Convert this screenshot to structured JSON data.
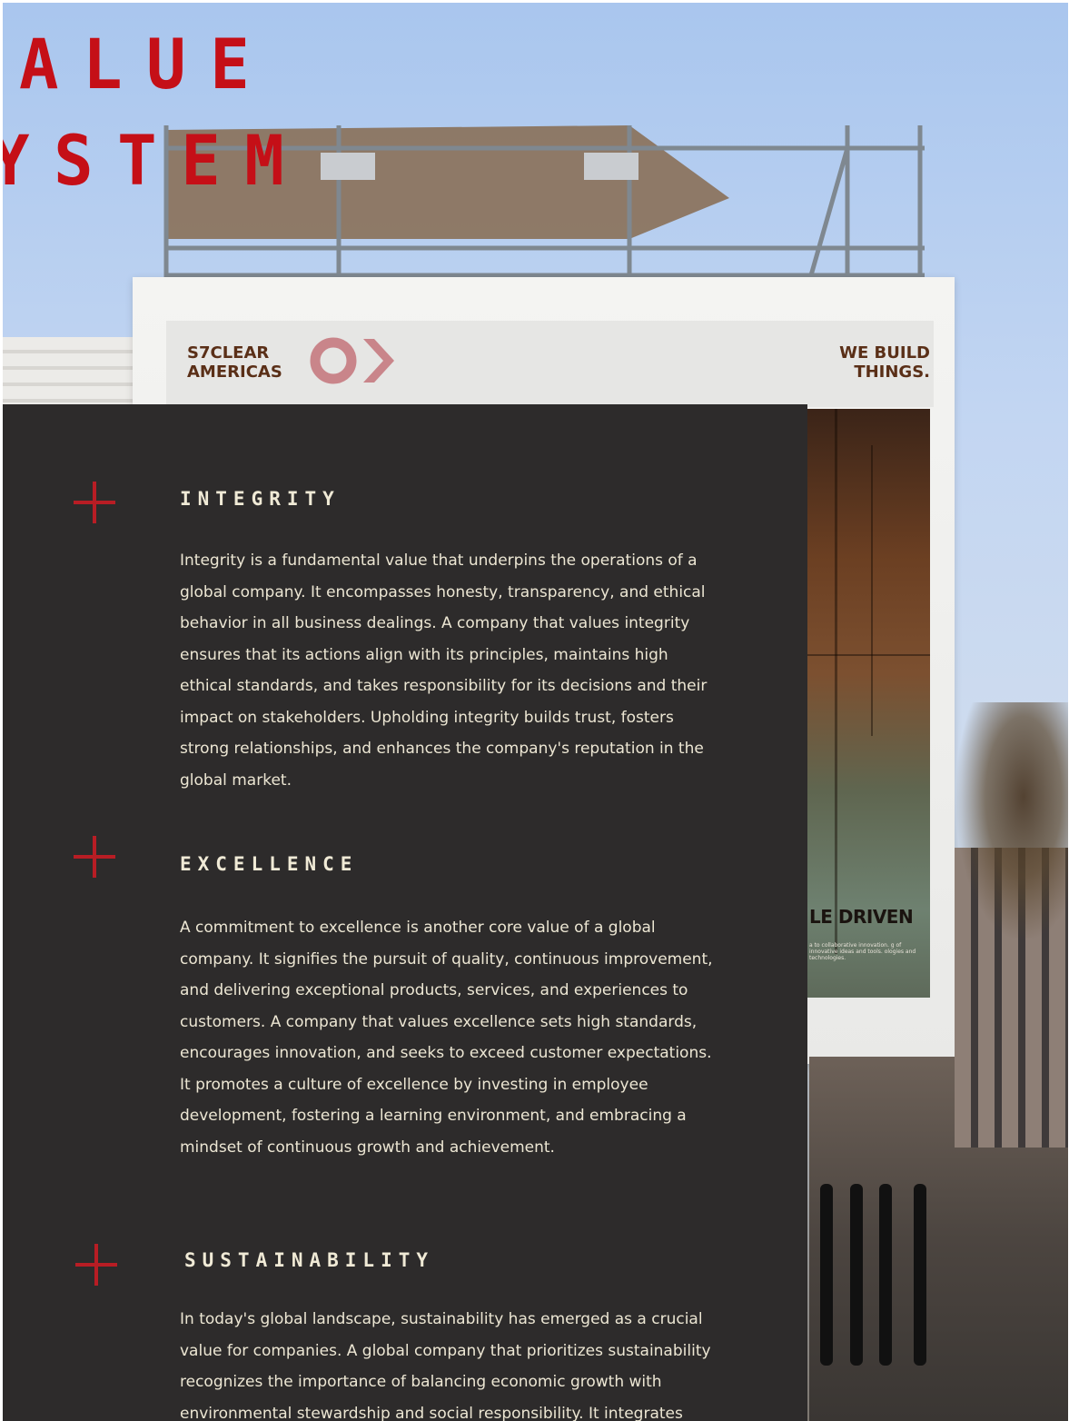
{
  "title": {
    "line1": "ALUE",
    "line2": "YSTEM"
  },
  "billboard": {
    "brand_left": "S7CLEAR\nAMERICAS",
    "brand_right": "WE BUILD\nTHINGS.",
    "poster_text": "LE DRIVEN",
    "poster_small": "a to collaborative innovation. g of innovative ideas and tools. ologies and technologies."
  },
  "values": [
    {
      "heading": "INTEGRITY",
      "body": "Integrity is a fundamental value that underpins the operations of a global company. It encompasses honesty, transparency, and ethical behavior in all business dealings. A company that values integrity ensures that its actions align with its principles, maintains high ethical standards, and takes responsibility for its decisions and their impact on stakeholders. Upholding integrity builds trust, fosters strong relationships, and enhances the company's reputation in the global market."
    },
    {
      "heading": "EXCELLENCE",
      "body": "A commitment to excellence is another core value of a global company. It signifies the pursuit of quality, continuous improvement, and delivering exceptional products, services, and experiences to customers. A company that values excellence sets high standards, encourages innovation, and seeks to exceed customer expectations. It promotes a culture of excellence by investing in employee development, fostering a learning environment, and embracing a mindset of continuous growth and achievement."
    },
    {
      "heading": "SUSTAINABILITY",
      "body": "In today's global landscape, sustainability has emerged as a crucial value for companies. A global company that prioritizes sustainability recognizes the importance of balancing economic growth with environmental stewardship and social responsibility. It integrates"
    }
  ],
  "colors": {
    "accent_red": "#c50f17",
    "plus_red": "#b81d24",
    "panel_bg": "#2d2b2b",
    "text_cream": "#ece6d3",
    "brand_brown": "#5a2f17"
  }
}
